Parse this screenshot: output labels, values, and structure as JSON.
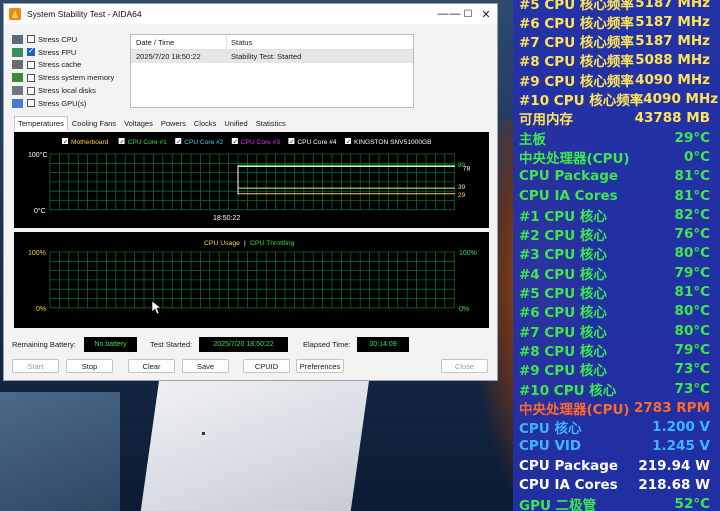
{
  "window": {
    "title": "System Stability Test - AIDA64",
    "controls": {
      "minimize": "—",
      "maximize": "☐",
      "close": "✕"
    }
  },
  "stress_options": [
    {
      "label": "Stress CPU",
      "checked": false,
      "icon": "cpu-icon"
    },
    {
      "label": "Stress FPU",
      "checked": true,
      "icon": "fpu-icon"
    },
    {
      "label": "Stress cache",
      "checked": false,
      "icon": "cache-icon"
    },
    {
      "label": "Stress system memory",
      "checked": false,
      "icon": "memory-icon"
    },
    {
      "label": "Stress local disks",
      "checked": false,
      "icon": "disk-icon"
    },
    {
      "label": "Stress GPU(s)",
      "checked": false,
      "icon": "monitor-icon"
    }
  ],
  "log": {
    "columns": [
      "Date / Time",
      "Status"
    ],
    "rows": [
      {
        "datetime": "2025/7/20 18:50:22",
        "status": "Stability Test: Started"
      }
    ]
  },
  "tabs": [
    "Temperatures",
    "Cooling Fans",
    "Voltages",
    "Powers",
    "Clocks",
    "Unified",
    "Statistics"
  ],
  "active_tab": "Temperatures",
  "temp_graph": {
    "legend": [
      {
        "label": "Motherboard",
        "color": "#ffd23a"
      },
      {
        "label": "CPU Core #1",
        "color": "#31e04a"
      },
      {
        "label": "CPU Core #2",
        "color": "#28d8e8"
      },
      {
        "label": "CPU Core #3",
        "color": "#e23ee8"
      },
      {
        "label": "CPU Core #4",
        "color": "#ffffff"
      },
      {
        "label": "KINGSTON SNV51000GB",
        "color": "#ffffff"
      }
    ],
    "y_top": "100°C",
    "y_bottom": "0°C",
    "x_label": "18:50:22",
    "right_values": [
      "80",
      "78",
      "29",
      "39"
    ]
  },
  "usage_graph": {
    "title_left": "CPU Usage",
    "separator": "|",
    "title_right": "CPU Throttling",
    "y_top_left": "100%",
    "y_bottom_left": "0%",
    "y_top_right": "100%",
    "y_bottom_right": "0%"
  },
  "chart_data": {
    "type": "line",
    "title": "",
    "xlabel": "18:50:22",
    "ylabel": "",
    "ylim": [
      0,
      100
    ],
    "series": [
      {
        "name": "Motherboard",
        "values": [
          29,
          29,
          29,
          29
        ]
      },
      {
        "name": "CPU Core #1",
        "values": [
          30,
          80,
          80,
          80
        ]
      },
      {
        "name": "CPU Core #4",
        "values": [
          28,
          78,
          78,
          78
        ]
      },
      {
        "name": "KINGSTON SNV51000GB",
        "values": [
          37,
          39,
          39,
          39
        ]
      }
    ]
  },
  "status_bar": {
    "remaining_battery_label": "Remaining Battery:",
    "remaining_battery_value": "No battery",
    "test_started_label": "Test Started:",
    "test_started_value": "2025/7/20 18:50:22",
    "elapsed_label": "Elapsed Time:",
    "elapsed_value": "00:14:09"
  },
  "buttons": {
    "start": "Start",
    "stop": "Stop",
    "clear": "Clear",
    "save": "Save",
    "cpuid": "CPUID",
    "preferences": "Preferences",
    "close": "Close"
  },
  "osd": {
    "rows": [
      {
        "label": "#5 CPU 核心频率",
        "value": "5187 MHz",
        "label_color": "#ffe45a",
        "value_color": "#ffe45a"
      },
      {
        "label": "#6 CPU 核心频率",
        "value": "5187 MHz",
        "label_color": "#ffe45a",
        "value_color": "#ffe45a"
      },
      {
        "label": "#7 CPU 核心频率",
        "value": "5187 MHz",
        "label_color": "#ffe45a",
        "value_color": "#ffe45a"
      },
      {
        "label": "#8 CPU 核心频率",
        "value": "5088 MHz",
        "label_color": "#ffe45a",
        "value_color": "#ffe45a"
      },
      {
        "label": "#9 CPU 核心频率",
        "value": "4090 MHz",
        "label_color": "#ffe45a",
        "value_color": "#ffe45a"
      },
      {
        "label": "#10 CPU 核心频率",
        "value": "4090 MHz",
        "label_color": "#ffe45a",
        "value_color": "#ffe45a"
      },
      {
        "label": "可用内存",
        "value": "43788 MB",
        "label_color": "#ffe45a",
        "value_color": "#ffe45a"
      },
      {
        "label": "主板",
        "value": "29°C",
        "label_color": "#3ee84c",
        "value_color": "#3ee84c"
      },
      {
        "label": "中央处理器(CPU)",
        "value": "0°C",
        "label_color": "#3ee84c",
        "value_color": "#3ee84c"
      },
      {
        "label": "CPU Package",
        "value": "81°C",
        "label_color": "#3ee84c",
        "value_color": "#3ee84c"
      },
      {
        "label": "CPU IA Cores",
        "value": "81°C",
        "label_color": "#3ee84c",
        "value_color": "#3ee84c"
      },
      {
        "label": " #1 CPU 核心",
        "value": "82°C",
        "label_color": "#3ee84c",
        "value_color": "#3ee84c"
      },
      {
        "label": " #2 CPU 核心",
        "value": "76°C",
        "label_color": "#3ee84c",
        "value_color": "#3ee84c"
      },
      {
        "label": " #3 CPU 核心",
        "value": "80°C",
        "label_color": "#3ee84c",
        "value_color": "#3ee84c"
      },
      {
        "label": " #4 CPU 核心",
        "value": "79°C",
        "label_color": "#3ee84c",
        "value_color": "#3ee84c"
      },
      {
        "label": " #5 CPU 核心",
        "value": "81°C",
        "label_color": "#3ee84c",
        "value_color": "#3ee84c"
      },
      {
        "label": " #6 CPU 核心",
        "value": "80°C",
        "label_color": "#3ee84c",
        "value_color": "#3ee84c"
      },
      {
        "label": " #7 CPU 核心",
        "value": "80°C",
        "label_color": "#3ee84c",
        "value_color": "#3ee84c"
      },
      {
        "label": " #8 CPU 核心",
        "value": "79°C",
        "label_color": "#3ee84c",
        "value_color": "#3ee84c"
      },
      {
        "label": " #9 CPU 核心",
        "value": "73°C",
        "label_color": "#3ee84c",
        "value_color": "#3ee84c"
      },
      {
        "label": " #10 CPU 核心",
        "value": "73°C",
        "label_color": "#3ee84c",
        "value_color": "#3ee84c"
      },
      {
        "label": "中央处理器(CPU)",
        "value": "2783 RPM",
        "label_color": "#ff6a2a",
        "value_color": "#ff6a2a"
      },
      {
        "label": "CPU 核心",
        "value": "1.200 V",
        "label_color": "#3bb6ff",
        "value_color": "#3bb6ff"
      },
      {
        "label": "CPU VID",
        "value": "1.245 V",
        "label_color": "#3bb6ff",
        "value_color": "#3bb6ff"
      },
      {
        "label": "CPU Package",
        "value": "219.94 W",
        "label_color": "#ffffff",
        "value_color": "#ffffff"
      },
      {
        "label": "CPU IA Cores",
        "value": "218.68 W",
        "label_color": "#ffffff",
        "value_color": "#ffffff"
      },
      {
        "label": "GPU 二极管",
        "value": "52°C",
        "label_color": "#3ee84c",
        "value_color": "#3ee84c"
      }
    ]
  }
}
